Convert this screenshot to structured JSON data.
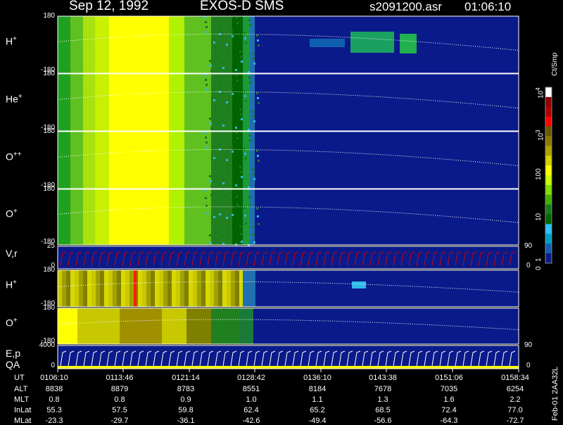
{
  "header": {
    "date": "Sep 12, 1992",
    "mission": "EXOS-D SMS",
    "file": "s2091200.asr",
    "time": "01:06:10"
  },
  "panels": [
    {
      "label": "H",
      "sup": "+",
      "ymax": "180",
      "ymin": "-180"
    },
    {
      "label": "He",
      "sup": "+",
      "ymax": "180",
      "ymin": "-180"
    },
    {
      "label": "O",
      "sup": "++",
      "ymax": "180",
      "ymin": "-180"
    },
    {
      "label": "O",
      "sup": "+",
      "ymax": "180",
      "ymin": "-180"
    },
    {
      "label": "V,r",
      "ymax": "25",
      "ymin": "0",
      "right_top": "90",
      "right_bottom": "0"
    },
    {
      "label": "H",
      "sup": "+",
      "ymax": "180",
      "ymin": "-180"
    },
    {
      "label": "O",
      "sup": "+",
      "ymax": "180",
      "ymin": "-180"
    },
    {
      "label": "E,p",
      "label2": "QA",
      "ymax": "4000",
      "ymin": "0",
      "right_top": "90",
      "right_bottom": "0"
    }
  ],
  "colorbar": {
    "unit": "Ct/Smp",
    "ticks": [
      {
        "base": "10",
        "exp": "4"
      },
      {
        "base": "10",
        "exp": "3"
      },
      {
        "text": "100"
      },
      {
        "text": "10"
      },
      {
        "text": "1"
      },
      {
        "text": "0"
      }
    ],
    "colors": [
      "#ffffff",
      "#8b0000",
      "#b00000",
      "#ff0000",
      "#6b5a00",
      "#8f7a00",
      "#b0a000",
      "#d8d000",
      "#ffff00",
      "#c8ff00",
      "#80e000",
      "#40b000",
      "#1a7a1a",
      "#006400",
      "#2ec0ff",
      "#00a0c0",
      "#1060b0",
      "#0a1a8a"
    ]
  },
  "footer_tag": "Feb-01  2AA32L",
  "orbit_table": {
    "row_labels": [
      "UT",
      "ALT",
      "MLT",
      "InLat",
      "MLat"
    ],
    "columns": [
      [
        "0106:10",
        "8838",
        "0.8",
        "55.3",
        "-23.3"
      ],
      [
        "0113:46",
        "8879",
        "0.8",
        "57.5",
        "-29.7"
      ],
      [
        "0121:14",
        "8783",
        "0.9",
        "59.8",
        "-36.1"
      ],
      [
        "0128:42",
        "8551",
        "1.0",
        "62.4",
        "-42.6"
      ],
      [
        "0136:10",
        "8184",
        "1.1",
        "65.2",
        "-49.4"
      ],
      [
        "0143:38",
        "7678",
        "1.3",
        "68.5",
        "-56.6"
      ],
      [
        "0151:06",
        "7035",
        "1.6",
        "72.4",
        "-64.3"
      ],
      [
        "0158:34",
        "6254",
        "2.2",
        "77.0",
        "-72.7"
      ]
    ]
  },
  "chart_data": {
    "type": "heatmap",
    "title": "Sep 12, 1992   EXOS-D SMS",
    "x": [
      "0106:10",
      "0113:46",
      "0121:14",
      "0128:42",
      "0136:10",
      "0143:38",
      "0151:06",
      "0158:34"
    ],
    "colorbar_label": "Ct/Smp",
    "colorbar_scale": "log",
    "colorbar_ticks": [
      "1",
      "10",
      "100",
      "10^3",
      "10^4"
    ],
    "series": [
      {
        "name": "H+",
        "ylim": [
          -180,
          180
        ]
      },
      {
        "name": "He+",
        "ylim": [
          -180,
          180
        ]
      },
      {
        "name": "O++",
        "ylim": [
          -180,
          180
        ]
      },
      {
        "name": "O+",
        "ylim": [
          -180,
          180
        ]
      },
      {
        "name": "V,r",
        "ylim": [
          0,
          25
        ],
        "y2lim": [
          0,
          90
        ]
      },
      {
        "name": "H+",
        "ylim": [
          -180,
          180
        ]
      },
      {
        "name": "O+",
        "ylim": [
          -180,
          180
        ]
      },
      {
        "name": "E,p / QA",
        "ylim": [
          0,
          4000
        ],
        "y2lim": [
          0,
          90
        ]
      }
    ]
  }
}
